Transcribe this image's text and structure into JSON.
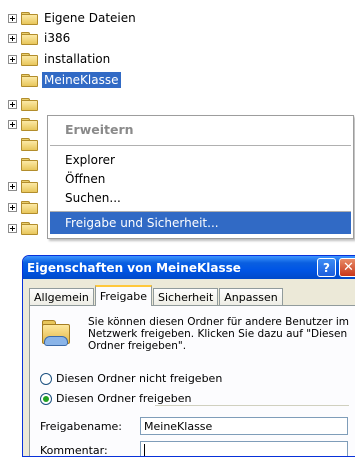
{
  "tree": {
    "items": [
      {
        "label": "Eigene Dateien"
      },
      {
        "label": "i386"
      },
      {
        "label": "installation"
      },
      {
        "label": "MeineKlasse"
      }
    ]
  },
  "context_menu": {
    "items": [
      {
        "label": "Erweitern"
      },
      {
        "label": "Explorer"
      },
      {
        "label": "Öffnen"
      },
      {
        "label": "Suchen..."
      },
      {
        "label": "Freigabe und Sicherheit..."
      }
    ]
  },
  "dialog": {
    "title": "Eigenschaften von MeineKlasse",
    "help_glyph": "?",
    "close_glyph": "✕",
    "tabs": [
      {
        "label": "Allgemein"
      },
      {
        "label": "Freigabe"
      },
      {
        "label": "Sicherheit"
      },
      {
        "label": "Anpassen"
      }
    ],
    "active_tab": "Freigabe",
    "description": "Sie können diesen Ordner für andere Benutzer im Netzwerk freigeben. Klicken Sie dazu auf \"Diesen Ordner freigeben\".",
    "radio_not_share": "Diesen Ordner nicht freigeben",
    "radio_share": "Diesen Ordner freigeben",
    "share_name_label": "Freigabename:",
    "share_name_value": "MeineKlasse",
    "comment_label": "Kommentar:",
    "comment_value": ""
  },
  "colors": {
    "selection": "#316ac5",
    "titlebar": "#0055e5",
    "dialog_face": "#ece9d8"
  }
}
